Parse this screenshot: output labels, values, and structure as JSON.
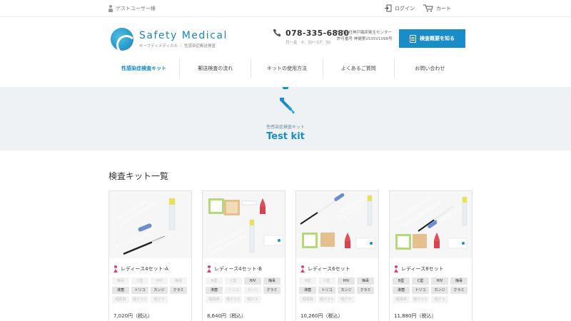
{
  "topbar": {
    "guest_label": "ゲストユーザー様",
    "login_label": "ログイン",
    "cart_label": "カート"
  },
  "header": {
    "brand": "Safety Medical",
    "brand_sub": "セーフティメディカル ｜ 性感染症郵送検査",
    "phone": "078-335-6880",
    "hours": "月～金　9：30～17：30",
    "company_line1": "株式会社神戸臨床衛生センター",
    "company_line2": "許可番号 神健第1535V1098号",
    "cta_label": "検査概要を知る"
  },
  "nav": [
    {
      "label": "性感染症検査キット",
      "active": true
    },
    {
      "label": "郵送検査の流れ",
      "active": false
    },
    {
      "label": "キットの使用方法",
      "active": false
    },
    {
      "label": "よくあるご質問",
      "active": false
    },
    {
      "label": "お問い合わせ",
      "active": false
    }
  ],
  "hero": {
    "subtitle": "性感染症検査キット",
    "title": "Test kit"
  },
  "section": {
    "title": "検査キット一覧"
  },
  "products": [
    {
      "name": "レディース4セット-A",
      "price": "7,020円（税込）",
      "tags": [
        {
          "t": "梅毒",
          "on": false
        },
        {
          "t": "C型",
          "on": false
        },
        {
          "t": "HIV",
          "on": false
        },
        {
          "t": "梅毒",
          "on": false
        },
        {
          "t": "淋菌",
          "on": true
        },
        {
          "t": "トリコ",
          "on": true
        },
        {
          "t": "カンジ",
          "on": true
        },
        {
          "t": "クラミ",
          "on": true
        },
        {
          "t": "咽頭淋",
          "on": false
        },
        {
          "t": "咽クラミ",
          "on": false
        },
        {
          "t": "咽グラ",
          "on": false
        }
      ]
    },
    {
      "name": "レディース4セット-B",
      "price": "8,640円（税込）",
      "tags": [
        {
          "t": "B型",
          "on": false
        },
        {
          "t": "C型",
          "on": false
        },
        {
          "t": "HIV",
          "on": true
        },
        {
          "t": "梅毒",
          "on": true
        },
        {
          "t": "淋菌",
          "on": true
        },
        {
          "t": "トリコ",
          "on": false
        },
        {
          "t": "カンジ",
          "on": false
        },
        {
          "t": "クラミ",
          "on": true
        },
        {
          "t": "咽頭淋",
          "on": false
        },
        {
          "t": "咽クラミ",
          "on": false
        },
        {
          "t": "咽グラ",
          "on": false
        }
      ]
    },
    {
      "name": "レディース6セット",
      "price": "10,260円（税込）",
      "tags": [
        {
          "t": "B型",
          "on": false
        },
        {
          "t": "C型",
          "on": false
        },
        {
          "t": "HIV",
          "on": true
        },
        {
          "t": "梅毒",
          "on": true
        },
        {
          "t": "淋菌",
          "on": true
        },
        {
          "t": "トリコ",
          "on": true
        },
        {
          "t": "カンジ",
          "on": true
        },
        {
          "t": "クラミ",
          "on": true
        },
        {
          "t": "咽頭淋",
          "on": false
        },
        {
          "t": "咽クラミ",
          "on": false
        },
        {
          "t": "咽グラ",
          "on": false
        }
      ]
    },
    {
      "name": "レディース8セット",
      "price": "11,880円（税込）",
      "tags": [
        {
          "t": "B型",
          "on": true
        },
        {
          "t": "C型",
          "on": true
        },
        {
          "t": "HIV",
          "on": true
        },
        {
          "t": "梅毒",
          "on": true
        },
        {
          "t": "淋菌",
          "on": true
        },
        {
          "t": "トリコ",
          "on": true
        },
        {
          "t": "カンジ",
          "on": true
        },
        {
          "t": "クラミ",
          "on": true
        },
        {
          "t": "咽頭淋",
          "on": false
        },
        {
          "t": "咽クラミ",
          "on": false
        },
        {
          "t": "咽グラ",
          "on": false
        }
      ]
    }
  ],
  "colors": {
    "accent": "#1a8cc8",
    "female": "#e0407a",
    "hero_bg": "#eef2f5"
  }
}
